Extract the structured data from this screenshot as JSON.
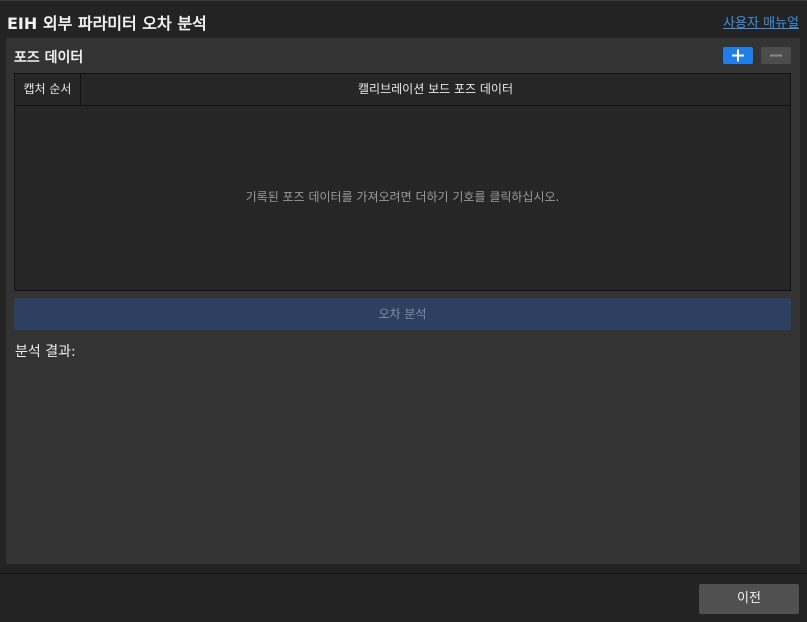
{
  "header": {
    "title": "EIH 외부 파라미터 오차 분석",
    "manual_link": "사용자 매뉴얼"
  },
  "pose_section": {
    "title": "포즈 데이터",
    "add_icon": "plus-icon",
    "remove_icon": "minus-icon",
    "table": {
      "columns": [
        "캡처 순서",
        "캘리브레이션 보드 포즈 데이터"
      ],
      "rows": [],
      "empty_message": "기록된 포즈 데이터를 가져오려면 더하기 기호를 클릭하십시오."
    }
  },
  "analyze_button": {
    "label": "오차 분석"
  },
  "result": {
    "label": "분석 결과:"
  },
  "footer": {
    "prev_label": "이전"
  },
  "colors": {
    "accent": "#1f7fe6",
    "link": "#3d8fe0",
    "disabled_button": "#2d4060",
    "panel": "#333333",
    "window": "#232323"
  }
}
